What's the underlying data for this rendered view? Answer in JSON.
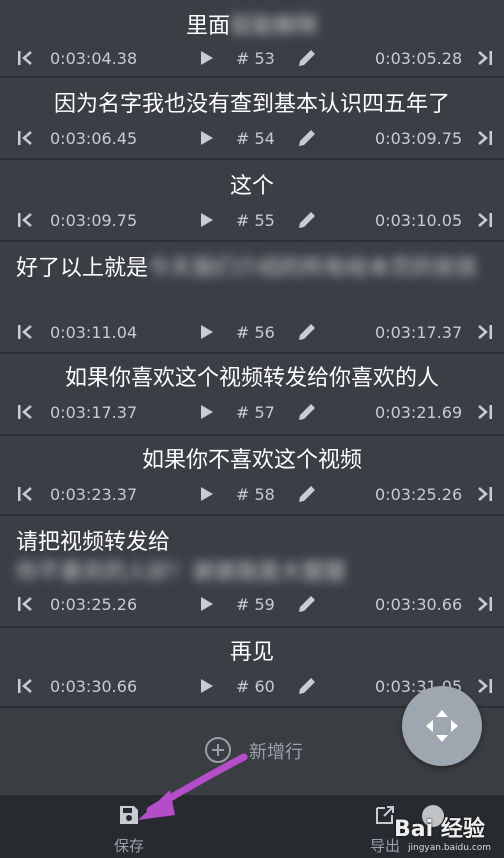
{
  "rows": [
    {
      "visible": "里面",
      "hidden": "挺能解释",
      "start": "0:03:04.38",
      "num": "# 53",
      "end": "0:03:05.28"
    },
    {
      "visible": "因为名字我也没有查到基本认识四五年了",
      "hidden": "",
      "start": "0:03:06.45",
      "num": "# 54",
      "end": "0:03:09.75"
    },
    {
      "visible": "这个",
      "hidden": "",
      "start": "0:03:09.75",
      "num": "# 55",
      "end": "0:03:10.05"
    },
    {
      "visible": "好了以上就是",
      "hidden": "今天我们介绍的所有给本页的安抚",
      "start": "0:03:11.04",
      "num": "# 56",
      "end": "0:03:17.37"
    },
    {
      "visible": "如果你喜欢这个视频转发给你喜欢的人",
      "hidden": "",
      "start": "0:03:17.37",
      "num": "# 57",
      "end": "0:03:21.69"
    },
    {
      "visible": "如果你不喜欢这个视频",
      "hidden": "",
      "start": "0:03:23.37",
      "num": "# 58",
      "end": "0:03:25.26"
    },
    {
      "visible": "请把视频转发给",
      "hidden": "你不喜欢的人好！谢谢我是大猩猩",
      "start": "0:03:25.26",
      "num": "# 59",
      "end": "0:03:30.66"
    },
    {
      "visible": "再见",
      "hidden": "",
      "start": "0:03:30.66",
      "num": "# 60",
      "end": "0:03:31.05"
    }
  ],
  "add_row_label": "新增行",
  "bottom_bar": {
    "save_label": "保存",
    "export_label": "导出"
  },
  "watermark": {
    "big": "Bai 经验",
    "small": "jingyan.baidu.com"
  },
  "icons": {
    "prev": "skip-previous-icon",
    "play": "play-icon",
    "edit": "pencil-icon",
    "next": "skip-next-icon",
    "move": "move-arrows-icon",
    "add": "add-circle-icon",
    "save": "save-floppy-icon",
    "export": "export-icon"
  },
  "colors": {
    "background": "#3a3d42",
    "card": "#3b3f45",
    "bottom_bar": "#272a2e",
    "fab": "#9ea6af",
    "annotation_arrow": "#b44ec8"
  }
}
